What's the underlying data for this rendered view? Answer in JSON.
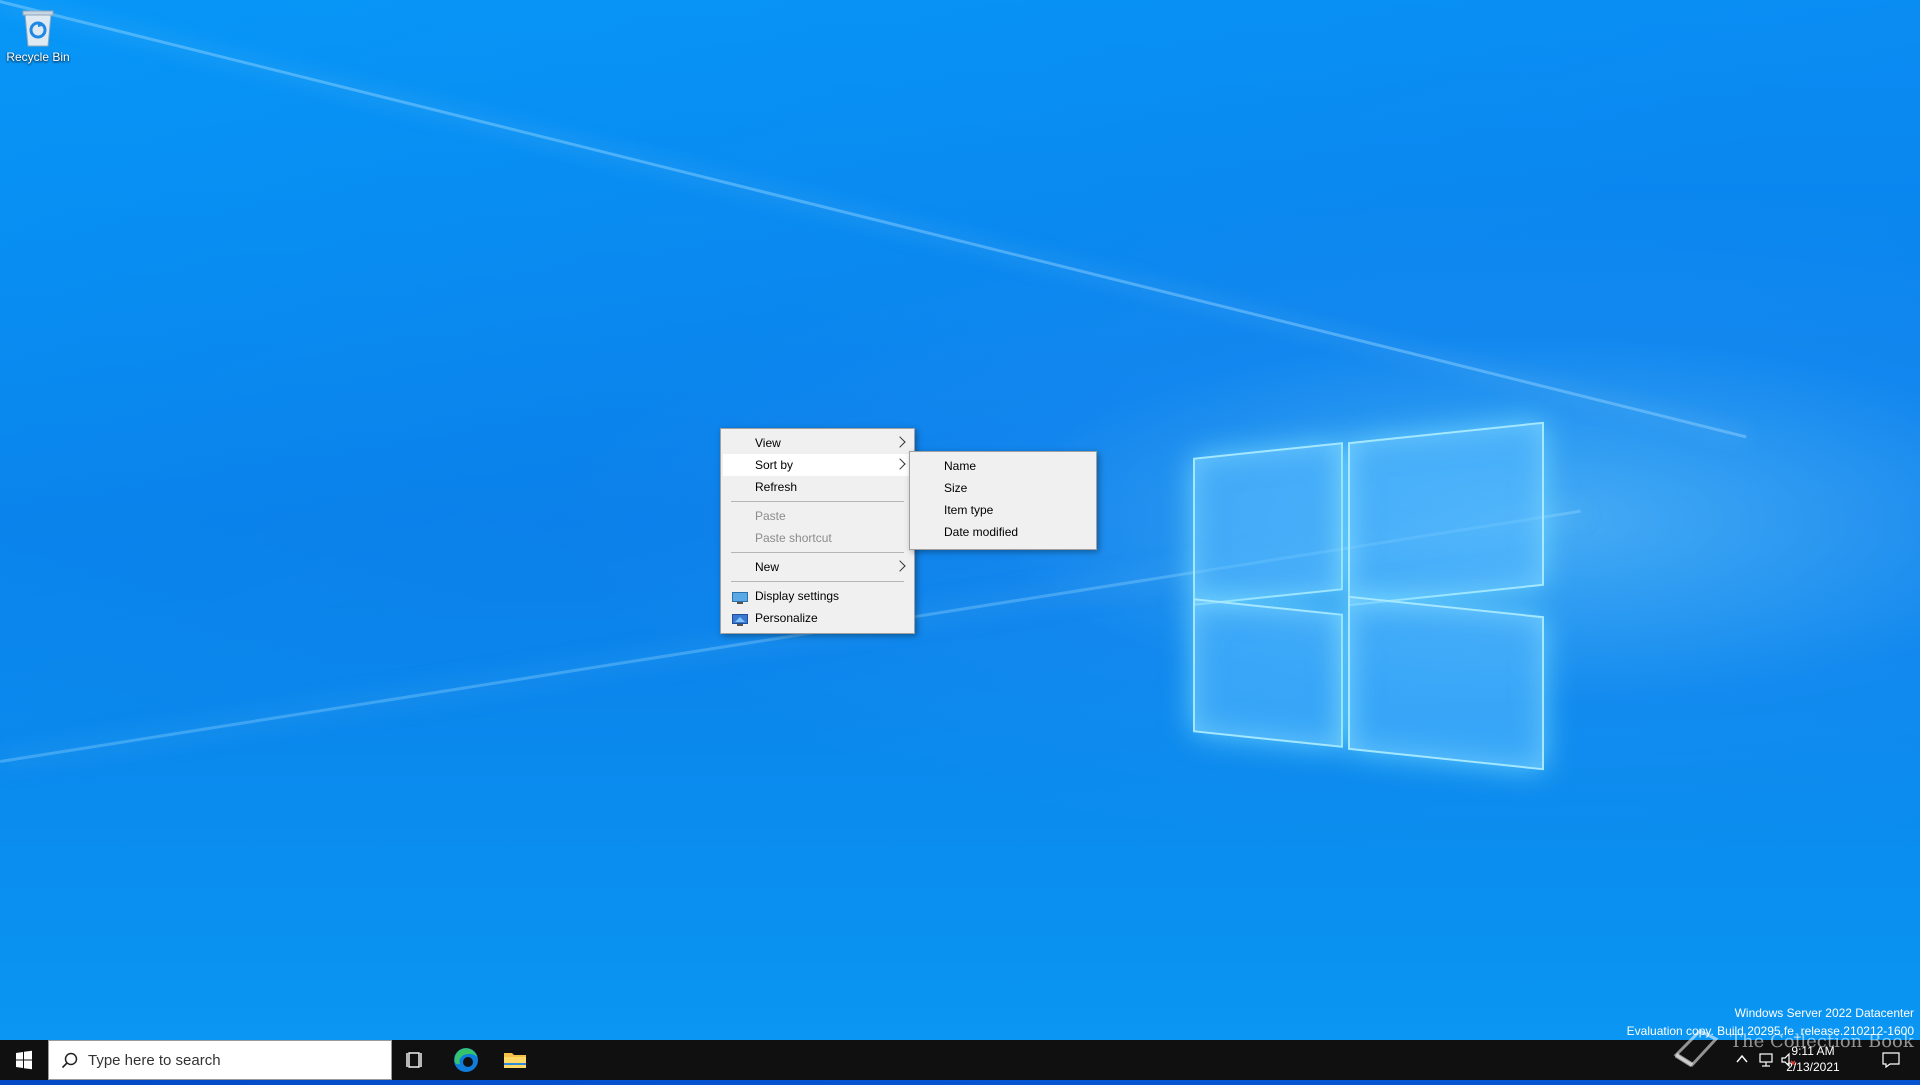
{
  "desktop": {
    "recycle_bin_label": "Recycle Bin"
  },
  "context_menu": {
    "items": [
      {
        "label": "View",
        "has_submenu": true
      },
      {
        "label": "Sort by",
        "has_submenu": true
      },
      {
        "label": "Refresh"
      },
      {
        "label": "Paste",
        "disabled": true
      },
      {
        "label": "Paste shortcut",
        "disabled": true
      },
      {
        "label": "New",
        "has_submenu": true
      },
      {
        "label": "Display settings",
        "icon": "display-settings-icon"
      },
      {
        "label": "Personalize",
        "icon": "personalize-icon"
      }
    ]
  },
  "sort_submenu": {
    "items": [
      "Name",
      "Size",
      "Item type",
      "Date modified"
    ]
  },
  "watermark": {
    "line1": "Windows Server 2022 Datacenter",
    "line2": "Evaluation copy. Build 20295.fe_release.210212-1600"
  },
  "taskbar": {
    "search_placeholder": "Type here to search",
    "time": "9:11 AM",
    "date": "2/13/2021",
    "overlay_text": "The Collection Book"
  },
  "colors": {
    "taskbar": "#101010",
    "menu_bg": "#f0f0f0",
    "desktop_blue": "#0a8cf3"
  }
}
